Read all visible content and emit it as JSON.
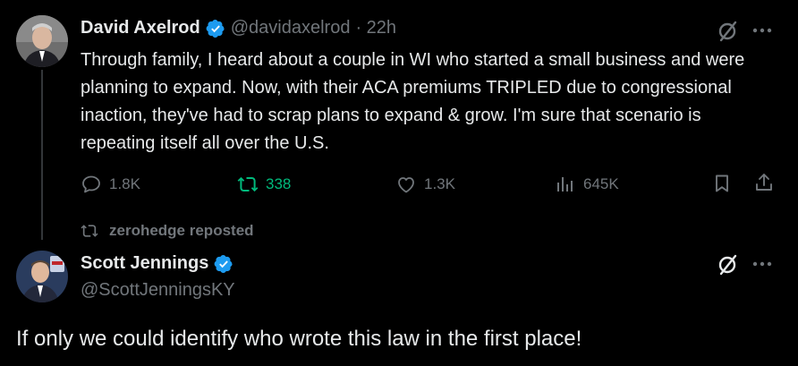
{
  "tweet1": {
    "name": "David Axelrod",
    "handle": "@davidaxelrod",
    "time": "· 22h",
    "text": "Through family, I heard about a couple in WI who started a small business and were planning to expand.  Now, with their ACA premiums TRIPLED due to congressional inaction, they've had to scrap plans to expand & grow.  I'm sure that scenario is repeating itself all over the U.S.",
    "replies": "1.8K",
    "reposts": "338",
    "likes": "1.3K",
    "views": "645K"
  },
  "repost_banner": "zerohedge reposted",
  "tweet2": {
    "name": "Scott Jennings",
    "handle": "@ScottJenningsKY",
    "text": "If only we could identify who wrote this law in the first place!"
  },
  "colors": {
    "background": "#000000",
    "text": "#e7e9ea",
    "muted": "#71767b",
    "verified": "#1d9bf0",
    "repost_active": "#00ba7c"
  }
}
